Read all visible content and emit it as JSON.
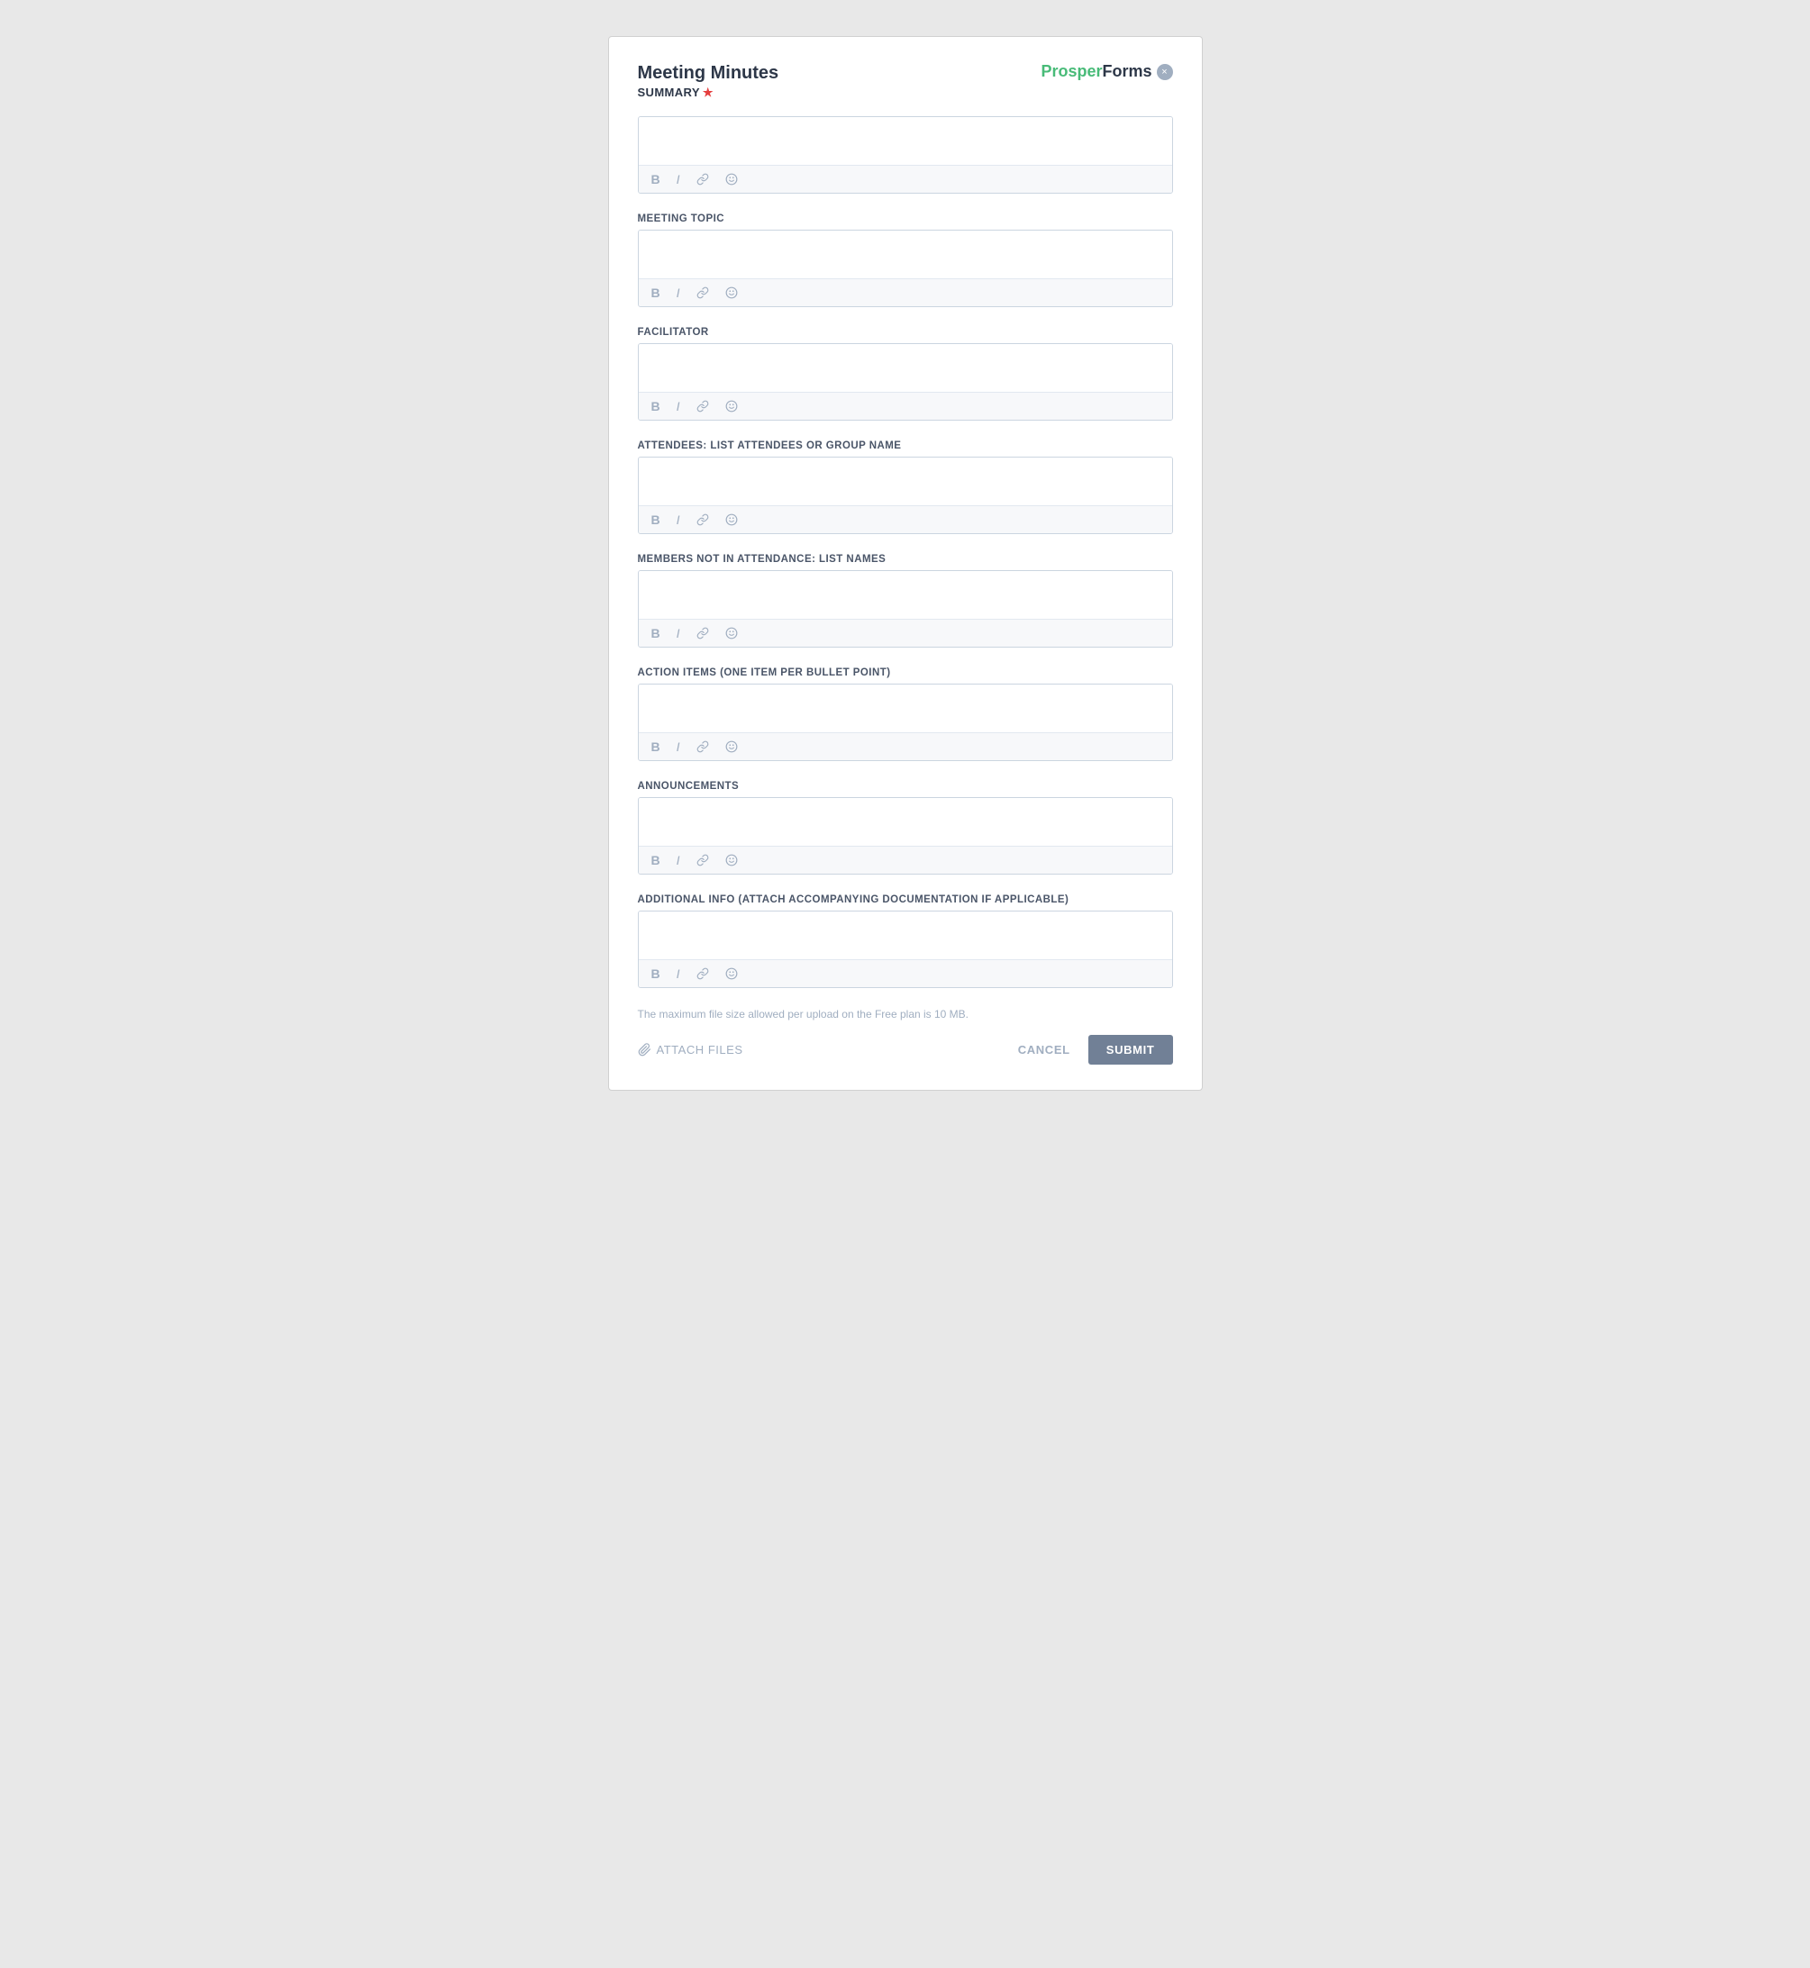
{
  "header": {
    "title": "Meeting Minutes",
    "logo_prosper": "Prosper",
    "logo_forms": "Forms",
    "close_label": "×"
  },
  "fields": [
    {
      "id": "summary",
      "label": "SUMMARY",
      "required": true,
      "toolbar": [
        "B",
        "I",
        "link",
        "emoji"
      ]
    },
    {
      "id": "meeting_topic",
      "label": "MEETING TOPIC",
      "required": false,
      "toolbar": [
        "B",
        "I",
        "link",
        "emoji"
      ]
    },
    {
      "id": "facilitator",
      "label": "FACILITATOR",
      "required": false,
      "toolbar": [
        "B",
        "I",
        "link",
        "emoji"
      ]
    },
    {
      "id": "attendees",
      "label": "ATTENDEES: LIST ATTENDEES OR GROUP NAME",
      "required": false,
      "toolbar": [
        "B",
        "I",
        "link",
        "emoji"
      ]
    },
    {
      "id": "members_not_in_attendance",
      "label": "MEMBERS NOT IN ATTENDANCE: LIST NAMES",
      "required": false,
      "toolbar": [
        "B",
        "I",
        "link",
        "emoji"
      ]
    },
    {
      "id": "action_items",
      "label": "ACTION ITEMS (ONE ITEM PER BULLET POINT)",
      "required": false,
      "toolbar": [
        "B",
        "I",
        "link",
        "emoji"
      ]
    },
    {
      "id": "announcements",
      "label": "ANNOUNCEMENTS",
      "required": false,
      "toolbar": [
        "B",
        "I",
        "link",
        "emoji"
      ]
    },
    {
      "id": "additional_info",
      "label": "ADDITIONAL INFO (ATTACH ACCOMPANYING DOCUMENTATION IF APPLICABLE)",
      "required": false,
      "toolbar": [
        "B",
        "I",
        "link",
        "emoji"
      ]
    }
  ],
  "footer": {
    "file_size_note": "The maximum file size allowed per upload on the Free plan is 10 MB.",
    "attach_files_label": "ATTACH FILES",
    "cancel_label": "CANCEL",
    "submit_label": "SUBMIT"
  }
}
